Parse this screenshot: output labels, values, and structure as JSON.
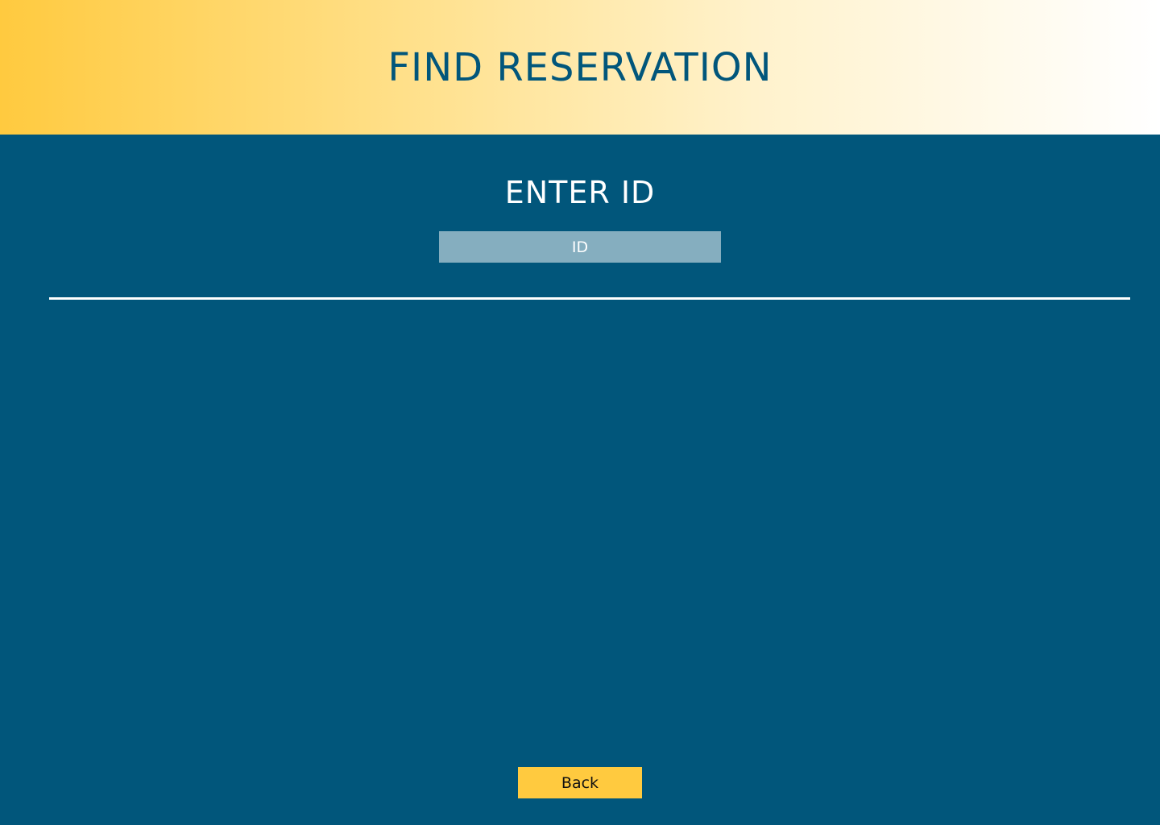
{
  "header": {
    "title": "FIND RESERVATION"
  },
  "main": {
    "heading": "ENTER ID",
    "id_input": {
      "placeholder": "ID",
      "value": ""
    },
    "back_label": "Back"
  },
  "colors": {
    "primary_blue": "#01567b",
    "accent_yellow": "#ffca3f",
    "input_fill": "#85aebf",
    "text_light": "#ffffff"
  }
}
